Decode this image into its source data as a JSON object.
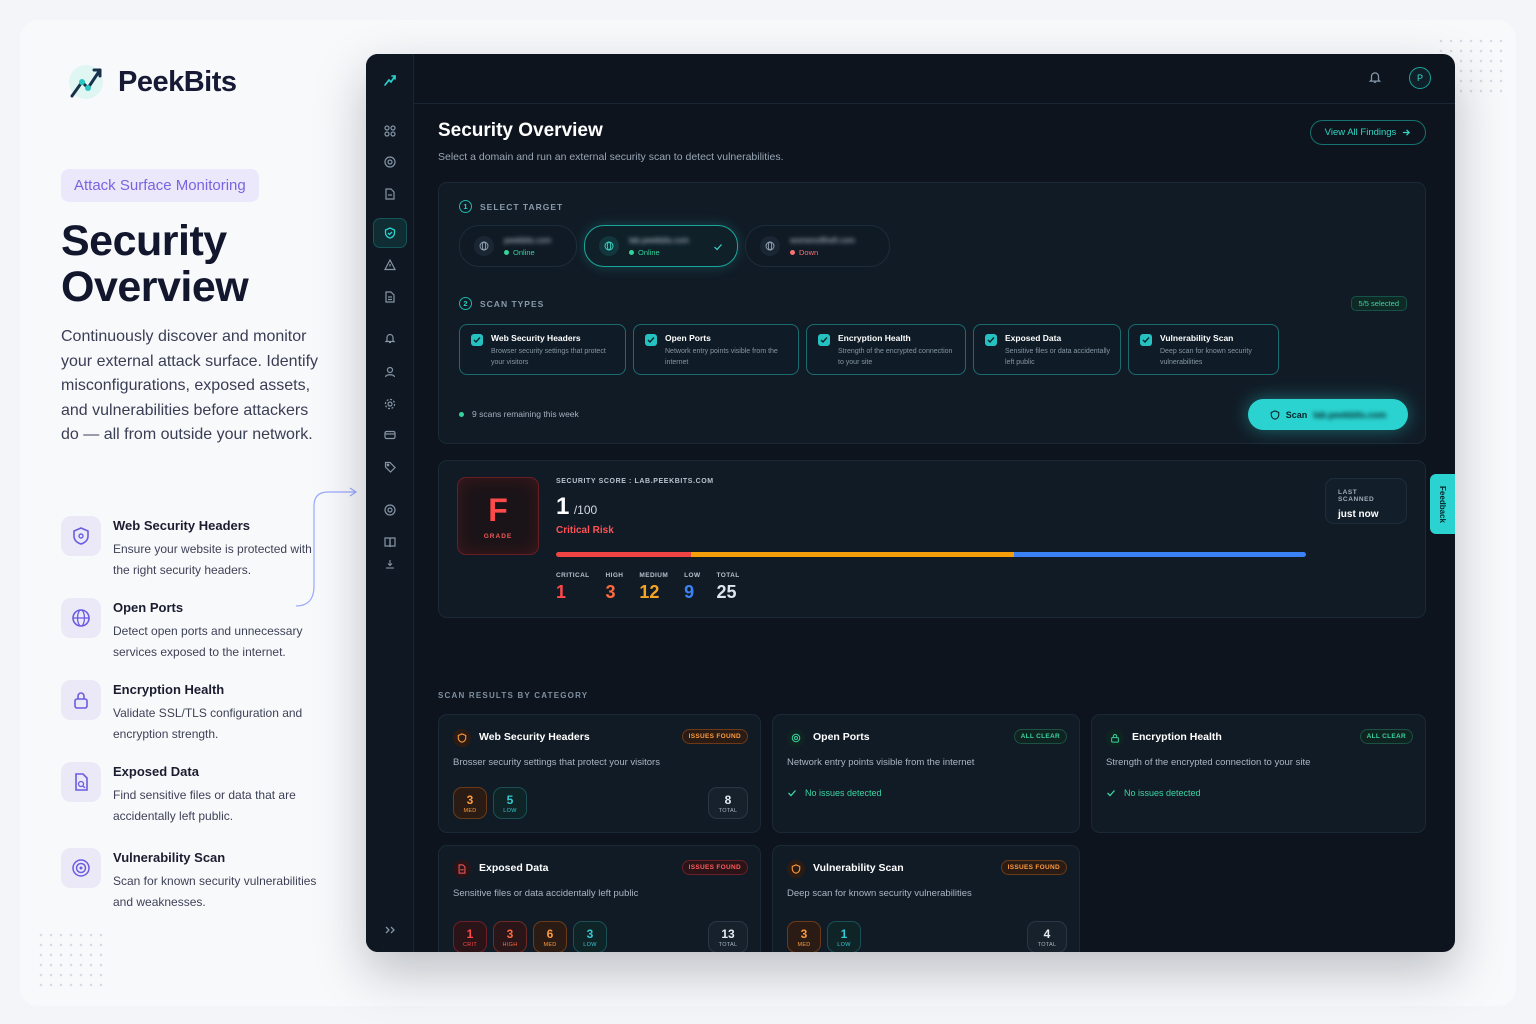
{
  "brand": {
    "name": "PeekBits"
  },
  "hero": {
    "tag": "Attack Surface Monitoring",
    "title": "Security Overview",
    "description": "Continuously discover and monitor your external attack surface. Identify misconfigurations, exposed assets, and vulnerabilities before attackers do — all from outside your network."
  },
  "features": [
    {
      "icon": "shield-icon",
      "title": "Web Security Headers",
      "desc": "Ensure your website is protected with the right security headers."
    },
    {
      "icon": "globe-icon",
      "title": "Open Ports",
      "desc": "Detect open ports and unnecessary services exposed to the internet."
    },
    {
      "icon": "lock-icon",
      "title": "Encryption Health",
      "desc": "Validate SSL/TLS configuration and encryption strength."
    },
    {
      "icon": "document-search-icon",
      "title": "Exposed Data",
      "desc": "Find sensitive files or data that are accidentally left public."
    },
    {
      "icon": "target-icon",
      "title": "Vulnerability Scan",
      "desc": "Scan for known security vulnerabilities and weaknesses."
    }
  ],
  "topbar": {
    "avatar": "P"
  },
  "page": {
    "title": "Security Overview",
    "subtitle": "Select a domain and run an external security scan to detect vulnerabilities.",
    "view_all": "View All Findings"
  },
  "select_target": {
    "step": "1",
    "label": "SELECT TARGET",
    "targets": [
      {
        "host": "peekbits.com",
        "status": "Online",
        "status_color": "#34d399"
      },
      {
        "host": "lab.peekbits.com",
        "status": "Online",
        "status_color": "#34d399",
        "selected": true
      },
      {
        "host": "womenofthefi.com",
        "status": "Down",
        "status_color": "#f87171"
      }
    ]
  },
  "scan_types": {
    "step": "2",
    "label": "SCAN TYPES",
    "selected_badge": "5/5 selected",
    "items": [
      {
        "title": "Web Security Headers",
        "desc": "Browser security settings that protect your visitors",
        "checked": true
      },
      {
        "title": "Open Ports",
        "desc": "Network entry points visible from the internet",
        "checked": true
      },
      {
        "title": "Encryption Health",
        "desc": "Strength of the encrypted connection to your site",
        "checked": true
      },
      {
        "title": "Exposed Data",
        "desc": "Sensitive files or data accidentally left public",
        "checked": true
      },
      {
        "title": "Vulnerability Scan",
        "desc": "Deep scan for known security vulnerabilities",
        "checked": true
      }
    ],
    "remaining": "9 scans remaining this week",
    "scan_button": "Scan",
    "scan_target": "lab.peekbits.com"
  },
  "score": {
    "grade": "F",
    "grade_label": "GRADE",
    "label": "SECURITY SCORE : LAB.PEEKBITS.COM",
    "value": "1",
    "max": "/100",
    "risk": "Critical Risk",
    "bar_segments": [
      {
        "fraction": 0.18,
        "color": "#ef4444"
      },
      {
        "fraction": 0.43,
        "color": "#f59e0b"
      },
      {
        "fraction": 0.39,
        "color": "#3b82f6"
      }
    ],
    "counts": [
      {
        "label": "CRITICAL",
        "value": "1",
        "color": "#ff4a4a"
      },
      {
        "label": "HIGH",
        "value": "3",
        "color": "#ff6a3d"
      },
      {
        "label": "MEDIUM",
        "value": "12",
        "color": "#f5a524"
      },
      {
        "label": "LOW",
        "value": "9",
        "color": "#3b82f6"
      },
      {
        "label": "TOTAL",
        "value": "25",
        "color": "#dfe5ec"
      }
    ],
    "last_scanned_label": "LAST SCANNED",
    "last_scanned_value": "just now"
  },
  "results": {
    "heading": "SCAN RESULTS BY CATEGORY",
    "cards": [
      {
        "title": "Web Security Headers",
        "badge": "ISSUES FOUND",
        "desc": "Brosser security settings that protect your visitors",
        "pills": [
          {
            "v": "3",
            "l": "MED"
          },
          {
            "v": "5",
            "l": "LOW"
          }
        ],
        "total": "8",
        "total_label": "TOTAL"
      },
      {
        "title": "Open Ports",
        "badge": "ALL CLEAR",
        "desc": "Network entry points visible from the internet",
        "clear": "No issues detected"
      },
      {
        "title": "Encryption Health",
        "badge": "ALL CLEAR",
        "desc": "Strength of the encrypted connection to your site",
        "clear": "No issues detected"
      },
      {
        "title": "Exposed Data",
        "badge": "ISSUES FOUND",
        "desc": "Sensitive files or data accidentally left public",
        "pills": [
          {
            "v": "1",
            "l": "CRIT"
          },
          {
            "v": "3",
            "l": "HIGH"
          },
          {
            "v": "6",
            "l": "MED"
          },
          {
            "v": "3",
            "l": "LOW"
          }
        ],
        "total": "13",
        "total_label": "TOTAL"
      },
      {
        "title": "Vulnerability Scan",
        "badge": "ISSUES FOUND",
        "desc": "Deep scan for known security vulnerabilities",
        "pills": [
          {
            "v": "3",
            "l": "MED"
          },
          {
            "v": "1",
            "l": "LOW"
          }
        ],
        "total": "4",
        "total_label": "TOTAL"
      }
    ]
  },
  "feedback": "Feedback",
  "colors": {
    "accent": "#2bd3d0",
    "critical": "#ff4a4a",
    "high": "#ff6a3d",
    "medium": "#f5a524",
    "low": "#3b82f6",
    "clear": "#3bd5a2"
  }
}
